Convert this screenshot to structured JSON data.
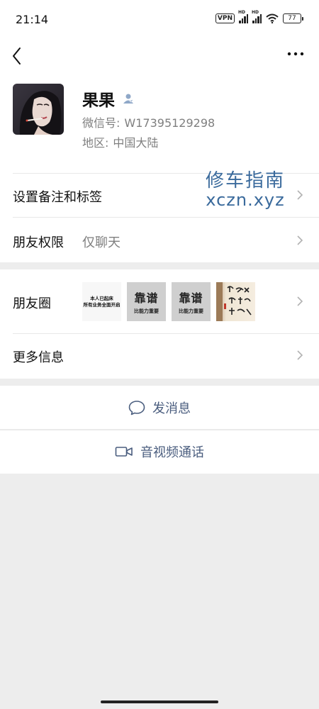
{
  "status_bar": {
    "time": "21:14",
    "vpn": "VPN",
    "hd1": "HD",
    "hd2": "HD",
    "battery": "77"
  },
  "profile": {
    "name": "果果",
    "wechat_id_label": "微信号:",
    "wechat_id": "W17395129298",
    "region_label": "地区:",
    "region": "中国大陆"
  },
  "rows": {
    "remark_label": "设置备注和标签",
    "permission_label": "朋友权限",
    "permission_value": "仅聊天",
    "moments_label": "朋友圈",
    "more_info_label": "更多信息"
  },
  "watermark": {
    "cn": "修车指南",
    "url": "xczn.xyz"
  },
  "moments_thumbs": {
    "thumb1_line1": "本人已起床",
    "thumb1_line2": "所有业务全面开启",
    "thumb2_big": "靠谱",
    "thumb2_small": "比能力重要",
    "thumb3_big": "靠谱",
    "thumb3_small": "比能力重要"
  },
  "actions": {
    "message": "发消息",
    "call": "音视频通话"
  },
  "colors": {
    "accent": "#4a5d7e",
    "watermark": "#3a6a9c",
    "verified": "#8fa8c8"
  }
}
